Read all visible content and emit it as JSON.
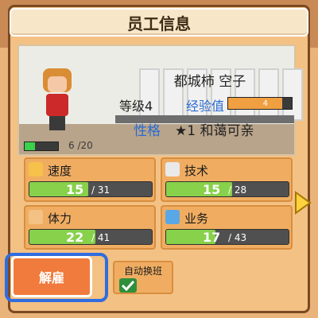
{
  "header": {
    "title": "员工信息"
  },
  "employee": {
    "name": "都城柿 空子",
    "level_text": "等级4",
    "exp_label": "经验值",
    "exp_value": "4",
    "exp_fraction": 0.85,
    "trait_label": "性格",
    "trait_value": "★1 和蔼可亲",
    "stamina_text": "6 /20",
    "stamina_fraction": 0.3
  },
  "stats": [
    {
      "label": "速度",
      "current": "15",
      "max": "/ 31",
      "fraction": 0.48,
      "icon": "speed-icon",
      "color": "#f6c14a"
    },
    {
      "label": "技术",
      "current": "15",
      "max": "/ 28",
      "fraction": 0.54,
      "icon": "tools-icon",
      "color": "#e9e9e9"
    },
    {
      "label": "体力",
      "current": "22",
      "max": "/ 41",
      "fraction": 0.54,
      "icon": "strength-icon",
      "color": "#f3c184"
    },
    {
      "label": "业务",
      "current": "17",
      "max": "/ 43",
      "fraction": 0.4,
      "icon": "business-icon",
      "color": "#5aa7e6"
    }
  ],
  "buttons": {
    "release": "解雇",
    "auto_shift": "自动换班"
  },
  "colors": {
    "accent_blue": "#2f6de0",
    "orange": "#f07b3c",
    "bar_green": "#87d14b"
  }
}
